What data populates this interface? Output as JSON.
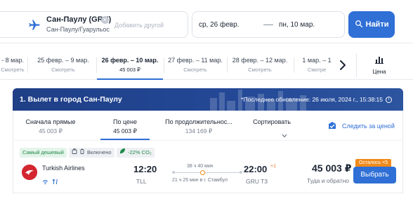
{
  "search": {
    "from_city": "Сан-Паулу (GRU)",
    "from_sub": "Сан-Паулу/Гуарульос",
    "add_another": "Добавить другой",
    "depart_date": "ср, 26 февр.",
    "return_date": "пн, 10 мар.",
    "find_label": "Найти"
  },
  "date_strip": {
    "items": [
      {
        "dates": "- 8 мар.",
        "price": "Смотреть"
      },
      {
        "dates": "25 февр. – 9 мар.",
        "price": "Смотреть"
      },
      {
        "dates": "26 февр. – 10 мар.",
        "price": "45 003 ₽"
      },
      {
        "dates": "27 февр. – 11 мар.",
        "price": "Смотреть"
      },
      {
        "dates": "28 февр. – 12 мар.",
        "price": "Смотреть"
      },
      {
        "dates": "1 мар. – 1",
        "price": "Смотре"
      }
    ],
    "price_toggle_label": "Цена"
  },
  "results": {
    "title": "1. Вылет в город Сан-Паулу",
    "last_update": "*Последнее обновление: 26 июля, 2024 г., 15:38:15"
  },
  "sort": {
    "items": [
      {
        "title": "Сначала прямые",
        "value": "45 003 ₽"
      },
      {
        "title": "По цене",
        "value": "45 003 ₽"
      },
      {
        "title": "По продолжительнос...",
        "value": "134 169 ₽"
      },
      {
        "title": "Сортировать",
        "value": ""
      }
    ],
    "track_price": "Следить за ценой"
  },
  "ticket": {
    "badge_cheapest": "Самый дешевый",
    "badge_included": "Включено",
    "badge_co2": "-22% CO₂",
    "airline": "Turkish Airlines",
    "dep_time": "12:20",
    "dep_code": "TLL",
    "duration": "38 ч 40 мин",
    "stop_info": "21 ч 25 мин в г. Стамбул",
    "arr_time": "22:00",
    "arr_plus": "+1",
    "arr_code": "GRU T3",
    "price": "45 003 ₽",
    "price_sub": "Туда и обратно",
    "seats_left": "Осталось <5",
    "select_label": "Выбрать"
  },
  "colors": {
    "accent": "#2f6fd6",
    "header_bg": "#244896",
    "cheapest_green": "#1f8a4a",
    "warning_orange": "#f08a1c",
    "airline_red": "#d22630"
  },
  "icons": [
    "plane-icon",
    "clear-icon",
    "search-icon",
    "chevron-right-icon",
    "bar-chart-icon",
    "info-icon",
    "chevron-down-icon",
    "price-alert-icon",
    "baggage-icon",
    "leaf-icon",
    "wifi-icon",
    "meal-icon"
  ]
}
